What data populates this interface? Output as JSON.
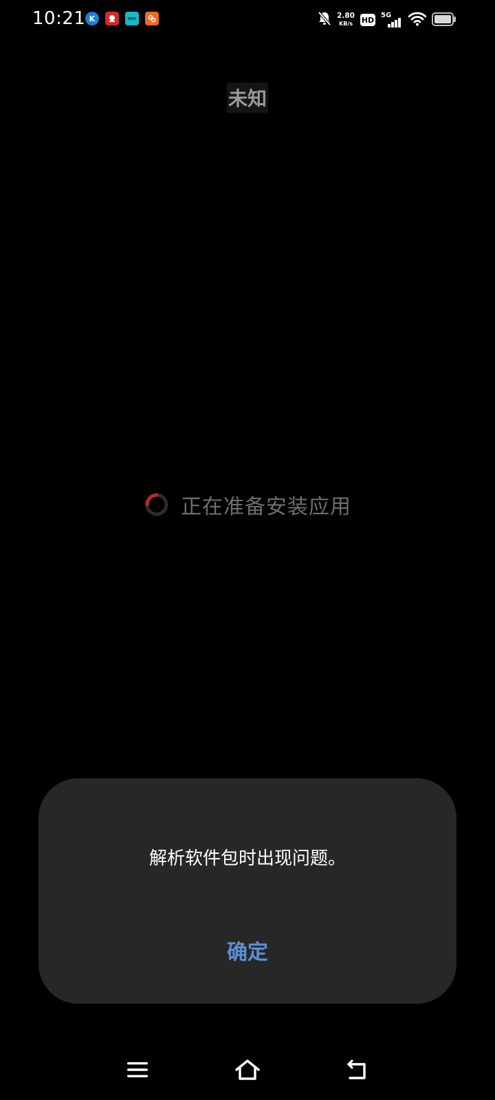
{
  "status_bar": {
    "time": "10:21",
    "net_speed_value": "2.80",
    "net_speed_unit": "KB/s",
    "hd_label": "HD",
    "network_type": "5G",
    "notification_icons": [
      {
        "name": "k-app-icon",
        "color": "#1a7fe0",
        "glyph": "K"
      },
      {
        "name": "red-app-icon",
        "color": "#d42a2a",
        "glyph": ""
      },
      {
        "name": "teal-app-icon",
        "color": "#18b8c9",
        "glyph": ""
      },
      {
        "name": "orange-app-icon",
        "color": "#f06a1e",
        "glyph": ""
      }
    ]
  },
  "app": {
    "title": "未知"
  },
  "progress": {
    "text": "正在准备安装应用"
  },
  "dialog": {
    "message": "解析软件包时出现问题。",
    "confirm_label": "确定"
  },
  "colors": {
    "background": "#000000",
    "dialog_background": "#272727",
    "accent": "#5b8fd6",
    "spinner_accent": "#c0262d"
  },
  "nav_bar": {
    "icons": [
      "menu-icon",
      "home-icon",
      "back-icon"
    ]
  }
}
